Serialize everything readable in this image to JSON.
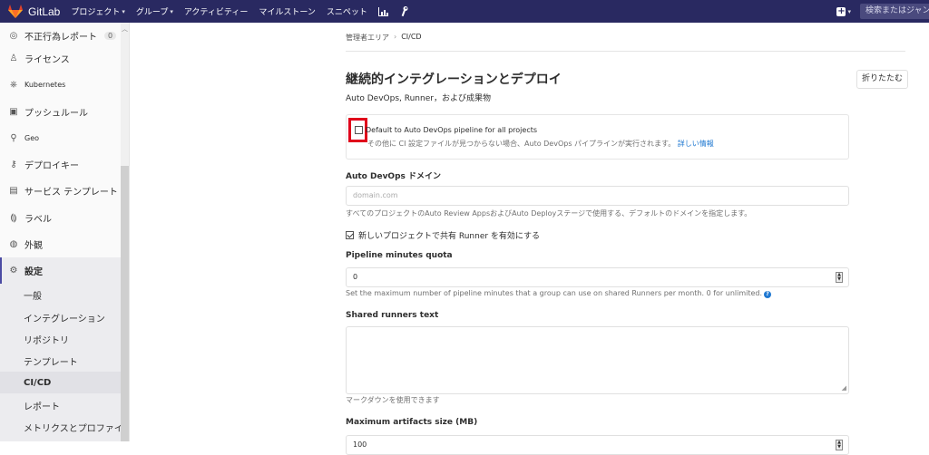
{
  "topbar": {
    "app_name": "GitLab",
    "nav": [
      {
        "label": "プロジェクト",
        "has_caret": true
      },
      {
        "label": "グループ",
        "has_caret": true
      },
      {
        "label": "アクティビティー",
        "has_caret": false
      },
      {
        "label": "マイルストーン",
        "has_caret": false
      },
      {
        "label": "スニペット",
        "has_caret": false
      }
    ],
    "icons": [
      "chart-icon",
      "wrench-icon"
    ],
    "search_text": "検索またはジャンプ",
    "bg_color": "#292961"
  },
  "sidebar": {
    "items": [
      {
        "label": "不正行為レポート",
        "icon": "circle-icon",
        "badge": "0"
      },
      {
        "label": "ライセンス",
        "icon": "users-icon"
      },
      {
        "label": "Kubernetes",
        "icon": "kubernetes-icon"
      },
      {
        "label": "プッシュルール",
        "icon": "push-icon"
      },
      {
        "label": "Geo",
        "icon": "location-icon"
      },
      {
        "label": "デプロイキー",
        "icon": "key-icon"
      },
      {
        "label": "サービス テンプレート",
        "icon": "template-icon"
      },
      {
        "label": "ラベル",
        "icon": "label-icon"
      },
      {
        "label": "外観",
        "icon": "appearance-icon"
      },
      {
        "label": "設定",
        "icon": "gear-icon",
        "active": true
      }
    ],
    "sub_items": [
      {
        "label": "一般"
      },
      {
        "label": "インテグレーション"
      },
      {
        "label": "リポジトリ"
      },
      {
        "label": "テンプレート"
      },
      {
        "label": "CI/CD",
        "active": true
      },
      {
        "label": "レポート"
      },
      {
        "label": "メトリクスとプロファイリング"
      }
    ]
  },
  "main": {
    "breadcrumb": {
      "parent": "管理者エリア",
      "sep": "›",
      "current": "CI/CD"
    },
    "section_title": "継続的インテグレーションとデプロイ",
    "section_subtitle": "Auto DevOps, Runner，および成果物",
    "collapse_label": "折りたたむ",
    "auto_devops": {
      "label": "Default to Auto DevOps pipeline for all projects",
      "help": "その他に CI 設定ファイルが見つからない場合、Auto DevOps パイプラインが実行されます。",
      "link": "詳しい情報",
      "checked": false
    },
    "domain": {
      "label": "Auto DevOps ドメイン",
      "placeholder": "domain.com",
      "help": "すべてのプロジェクトのAuto Review AppsおよびAuto Deployステージで使用する、デフォルトのドメインを指定します。"
    },
    "shared_runners": {
      "label": "新しいプロジェクトで共有 Runner を有効にする",
      "checked": true
    },
    "minutes_quota": {
      "label": "Pipeline minutes quota",
      "value": "0",
      "help": "Set the maximum number of pipeline minutes that a group can use on shared Runners per month. 0 for unlimited."
    },
    "shared_text": {
      "label": "Shared runners text",
      "help": "マークダウンを使用できます"
    },
    "artifacts": {
      "label": "Maximum artifacts size (MB)",
      "value": "100"
    }
  }
}
